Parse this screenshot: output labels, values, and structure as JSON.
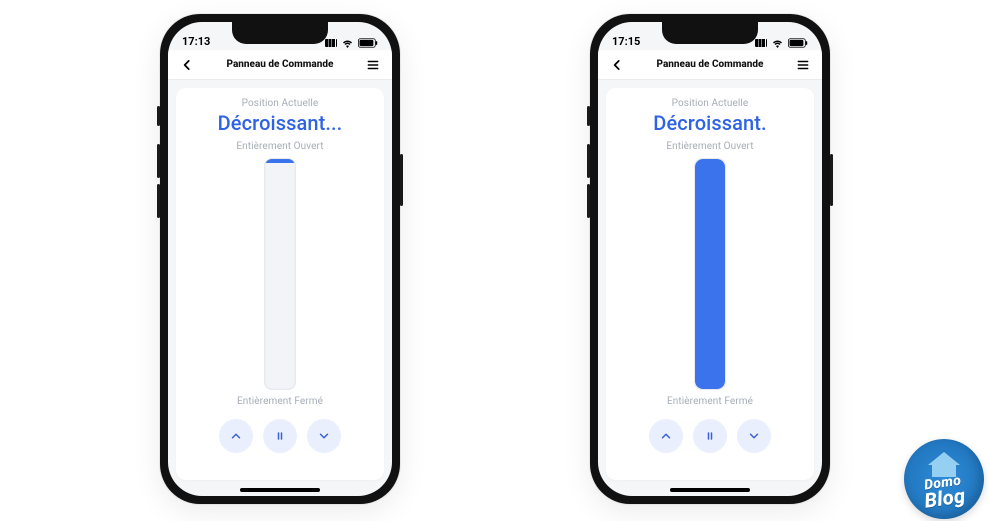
{
  "phones": [
    {
      "status": {
        "time": "17:13"
      },
      "titlebar": {
        "title": "Panneau de Commande"
      },
      "panel": {
        "position_label": "Position Actuelle",
        "hero": "Décroissant...",
        "open_label": "Entièrement Ouvert",
        "closed_label": "Entièrement Fermé",
        "fill": "top"
      }
    },
    {
      "status": {
        "time": "17:15"
      },
      "titlebar": {
        "title": "Panneau de Commande"
      },
      "panel": {
        "position_label": "Position Actuelle",
        "hero": "Décroissant.",
        "open_label": "Entièrement Ouvert",
        "closed_label": "Entièrement Fermé",
        "fill": "full"
      }
    }
  ],
  "watermark": {
    "line1": "Domo",
    "line2": "Blog"
  }
}
